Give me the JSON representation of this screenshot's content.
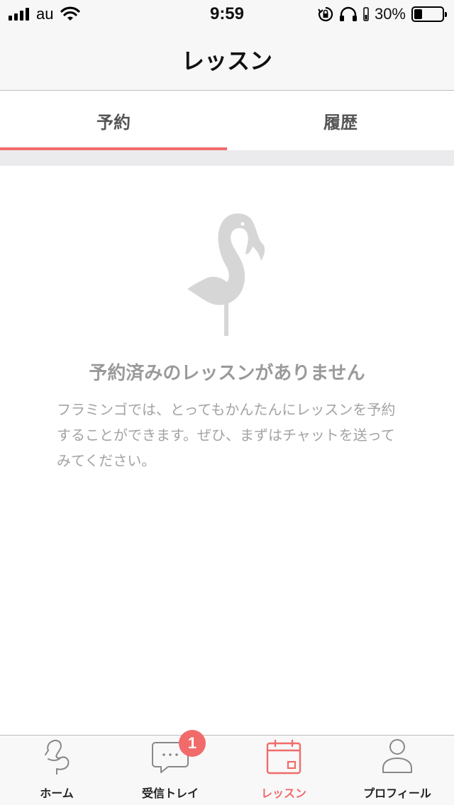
{
  "status_bar": {
    "carrier": "au",
    "time": "9:59",
    "battery_percent": "30%",
    "battery_level": 0.3
  },
  "nav": {
    "title": "レッスン"
  },
  "tabs": [
    {
      "label": "予約",
      "active": true
    },
    {
      "label": "履歴",
      "active": false
    }
  ],
  "empty_state": {
    "illustration": "flamingo-illustration",
    "title": "予約済みのレッスンがありません",
    "description": "フラミンゴでは、とってもかんたんにレッスンを予約することができます。ぜひ、まずはチャットを送ってみてください。"
  },
  "tab_bar": {
    "items": [
      {
        "label": "ホーム",
        "icon": "flamingo-icon",
        "active": false
      },
      {
        "label": "受信トレイ",
        "icon": "chat-icon",
        "active": false,
        "badge": "1"
      },
      {
        "label": "レッスン",
        "icon": "calendar-icon",
        "active": true
      },
      {
        "label": "プロフィール",
        "icon": "person-icon",
        "active": false
      }
    ]
  },
  "colors": {
    "accent": "#f16b6b",
    "muted_text": "#9a9a9a",
    "illustration": "#d6d6d6"
  }
}
